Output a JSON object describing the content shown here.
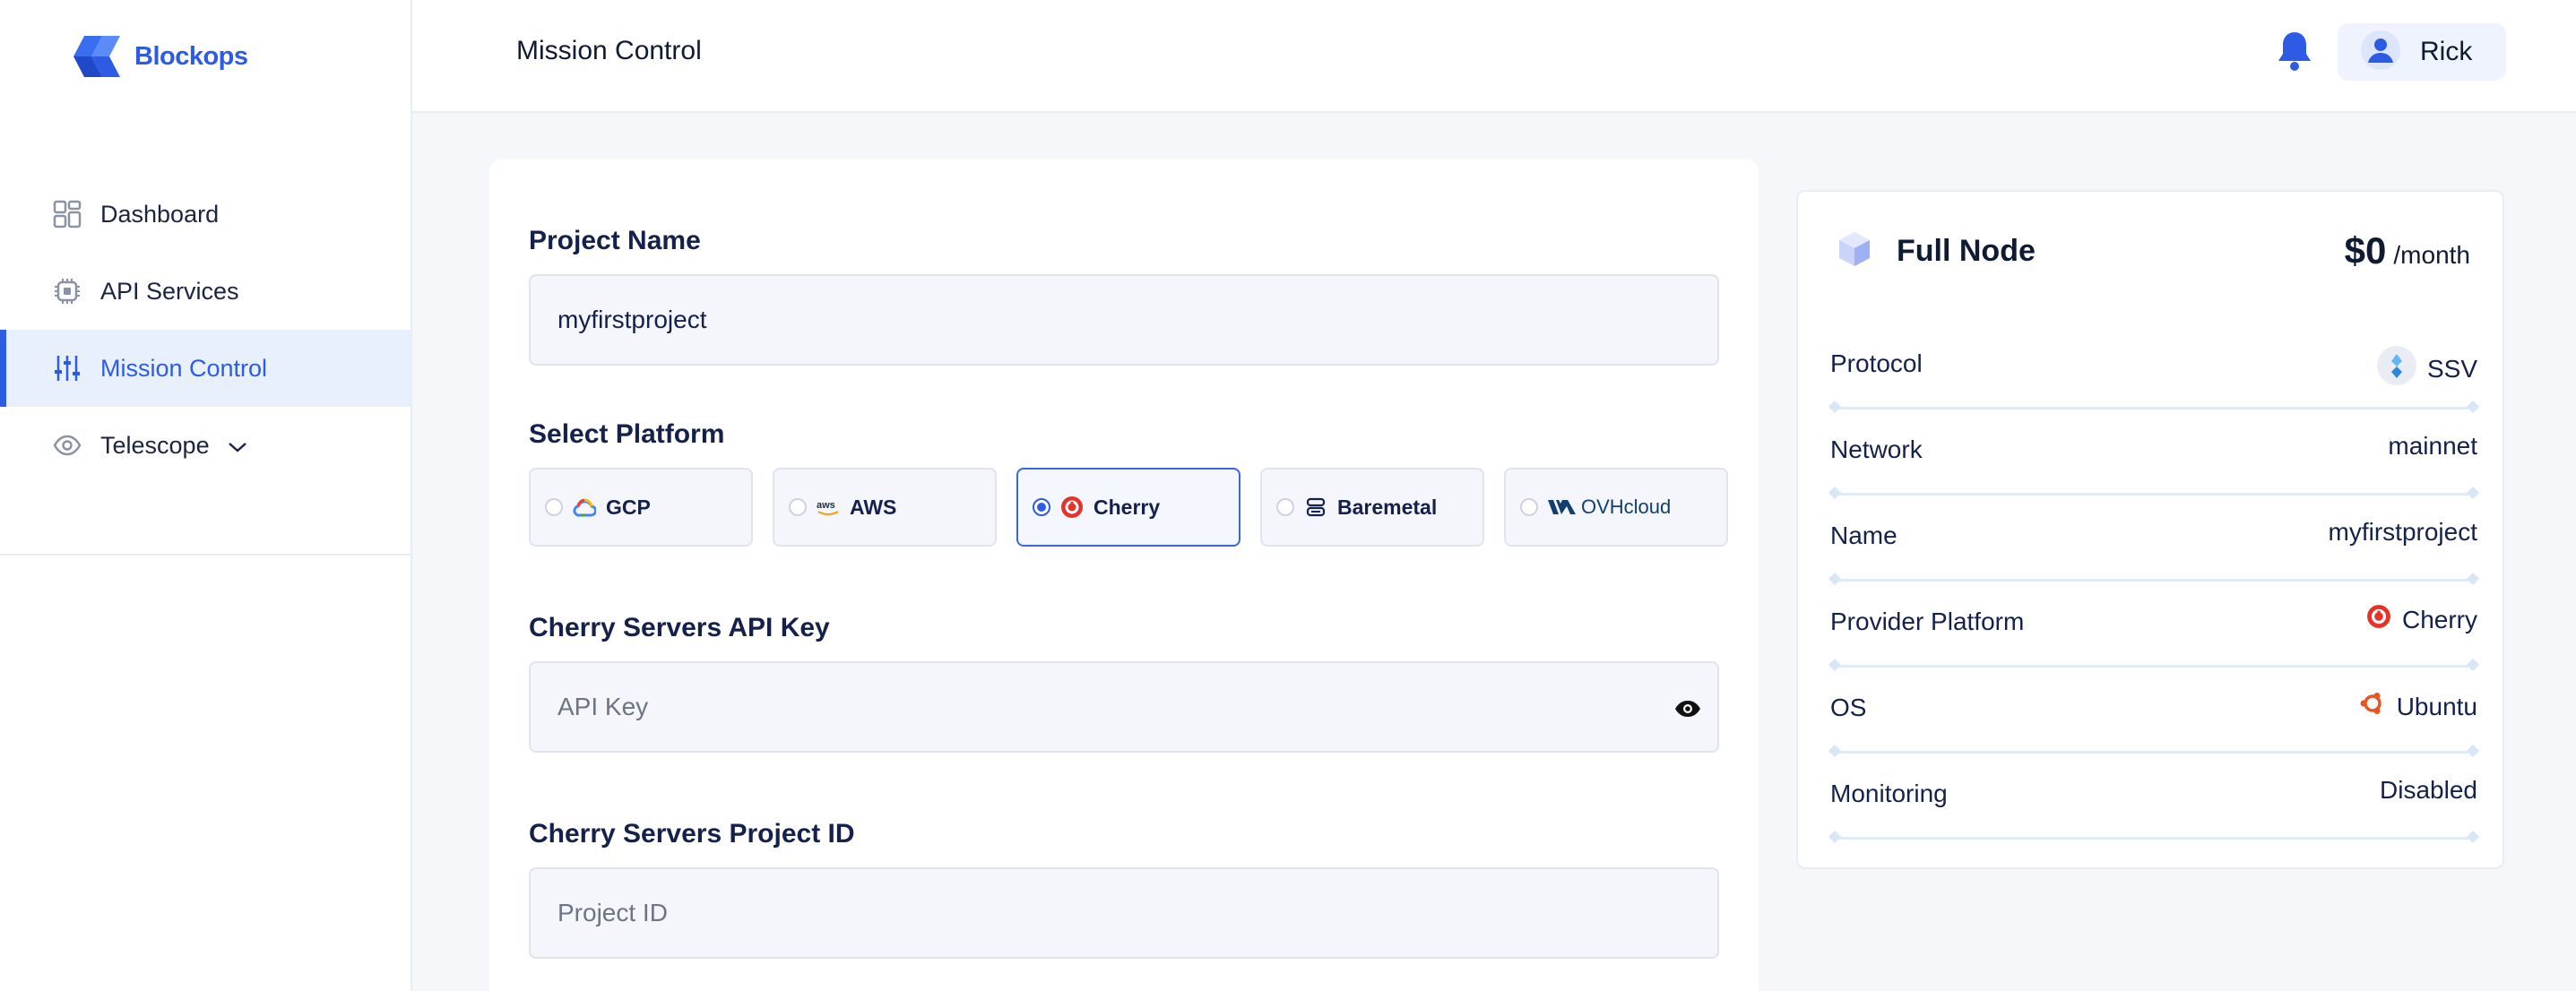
{
  "app": {
    "brand": "Blockops"
  },
  "sidebar": {
    "items": [
      {
        "label": "Dashboard",
        "icon": "dashboard-icon"
      },
      {
        "label": "API Services",
        "icon": "chip-icon"
      },
      {
        "label": "Mission Control",
        "icon": "sliders-icon",
        "active": true
      },
      {
        "label": "Telescope",
        "icon": "eye-icon"
      }
    ]
  },
  "header": {
    "title": "Mission Control",
    "user": "Rick"
  },
  "form": {
    "project_name_label": "Project Name",
    "project_name_value": "myfirstproject",
    "platform_label": "Select Platform",
    "platforms": [
      {
        "label": "GCP",
        "icon": "gcp-icon"
      },
      {
        "label": "AWS",
        "icon": "aws-icon"
      },
      {
        "label": "Cherry",
        "icon": "cherry-icon",
        "selected": true
      },
      {
        "label": "Baremetal",
        "icon": "server-icon"
      },
      {
        "label": "OVHcloud",
        "icon": "ovhcloud-logo"
      }
    ],
    "api_key_label": "Cherry Servers API Key",
    "api_key_placeholder": "API Key",
    "project_id_label": "Cherry Servers Project ID",
    "project_id_placeholder": "Project ID"
  },
  "summary": {
    "title": "Full Node",
    "price": "$0",
    "price_unit": "/month",
    "rows": [
      {
        "key": "Protocol",
        "value": "SSV",
        "icon": "ssv-icon"
      },
      {
        "key": "Network",
        "value": "mainnet"
      },
      {
        "key": "Name",
        "value": "myfirstproject"
      },
      {
        "key": "Provider Platform",
        "value": "Cherry",
        "icon": "cherry-icon"
      },
      {
        "key": "OS",
        "value": "Ubuntu",
        "icon": "ubuntu-icon"
      },
      {
        "key": "Monitoring",
        "value": "Disabled"
      }
    ]
  },
  "colors": {
    "accent": "#2d5be3",
    "cherry": "#e5332a",
    "ubuntu": "#e95420"
  }
}
